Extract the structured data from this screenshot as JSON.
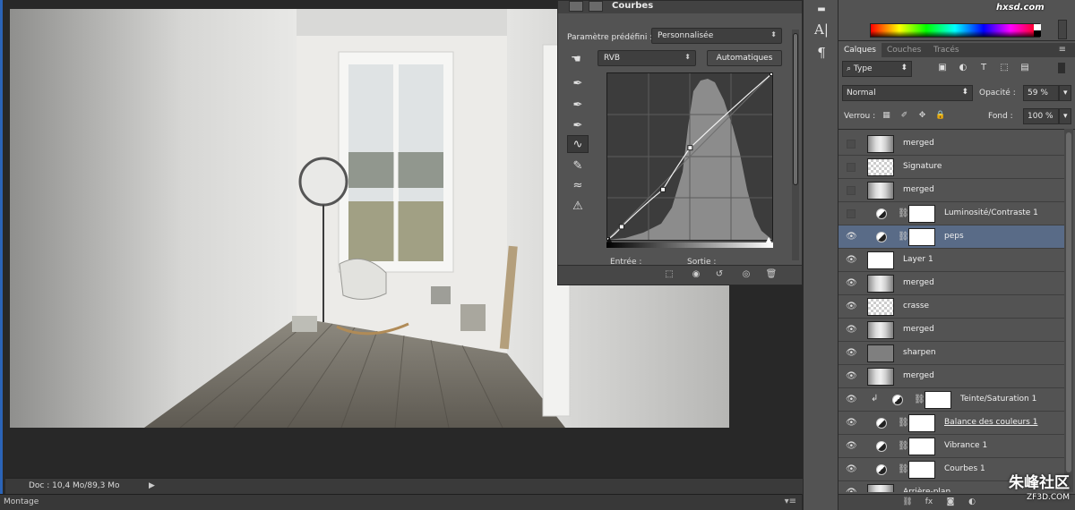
{
  "status_bar": {
    "doc_info": "Doc : 10,4 Mo/89,3 Mo"
  },
  "bottom_bar": {
    "label": "Montage"
  },
  "curves": {
    "title": "Courbes",
    "preset_label": "Paramètre prédéfini :",
    "preset_value": "Personnalisée",
    "channel_value": "RVB",
    "auto_label": "Automatiques",
    "input_label": "Entrée :",
    "output_label": "Sortie :",
    "points": [
      [
        0,
        0
      ],
      [
        22,
        20
      ],
      [
        86,
        77
      ],
      [
        128,
        141
      ],
      [
        255,
        255
      ]
    ]
  },
  "color_panel": {
    "watermark": "hxsd.com"
  },
  "layers": {
    "tabs": [
      "Calques",
      "Couches",
      "Tracés"
    ],
    "filter_type": "Type",
    "blend_mode": "Normal",
    "opacity_label": "Opacité :",
    "opacity_value": "59 %",
    "lock_label": "Verrou :",
    "fill_label": "Fond :",
    "fill_value": "100 %",
    "items": [
      {
        "name": "merged",
        "visible": false,
        "thumb": "img",
        "adjustment": false
      },
      {
        "name": "Signature",
        "visible": false,
        "thumb": "checker",
        "adjustment": false
      },
      {
        "name": "merged",
        "visible": false,
        "thumb": "img",
        "adjustment": false
      },
      {
        "name": "Luminosité/Contraste 1",
        "visible": false,
        "thumb": "white",
        "adjustment": true
      },
      {
        "name": "peps",
        "visible": true,
        "thumb": "white",
        "adjustment": true,
        "selected": true
      },
      {
        "name": "Layer 1",
        "visible": true,
        "thumb": "white",
        "adjustment": false
      },
      {
        "name": "merged",
        "visible": true,
        "thumb": "img",
        "adjustment": false
      },
      {
        "name": "crasse",
        "visible": true,
        "thumb": "checker",
        "adjustment": false
      },
      {
        "name": "merged",
        "visible": true,
        "thumb": "img",
        "adjustment": false
      },
      {
        "name": "sharpen",
        "visible": true,
        "thumb": "gray",
        "adjustment": false
      },
      {
        "name": "merged",
        "visible": true,
        "thumb": "img",
        "adjustment": false
      },
      {
        "name": "Teinte/Saturation 1",
        "visible": true,
        "thumb": "white",
        "adjustment": true,
        "clipped": true
      },
      {
        "name": "Balance des couleurs 1",
        "visible": true,
        "thumb": "white",
        "adjustment": true,
        "underline": true
      },
      {
        "name": "Vibrance 1",
        "visible": true,
        "thumb": "white",
        "adjustment": true
      },
      {
        "name": "Courbes 1",
        "visible": true,
        "thumb": "white",
        "adjustment": true
      },
      {
        "name": "Arrière-plan",
        "visible": true,
        "thumb": "img",
        "adjustment": false
      }
    ]
  },
  "watermark_bottom": {
    "main": "朱峰社区",
    "sub": "ZF3D.COM"
  },
  "colors": {
    "accent_border": "#2b64b8",
    "selected_layer": "#596b87"
  }
}
